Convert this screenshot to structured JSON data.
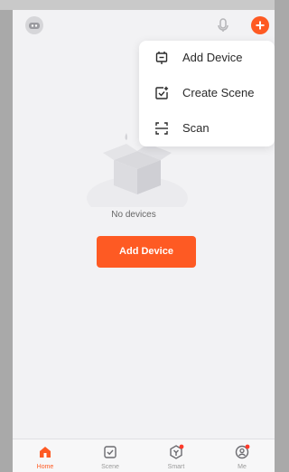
{
  "theme": {
    "accent": "#fe5a23"
  },
  "header": {
    "avatar_icon": "home-robot-icon",
    "mic_icon": "microphone-icon",
    "add_icon": "plus-circle-icon"
  },
  "menu": {
    "items": [
      {
        "label": "Add Device",
        "icon": "add-device-icon"
      },
      {
        "label": "Create Scene",
        "icon": "create-scene-icon"
      },
      {
        "label": "Scan",
        "icon": "scan-icon"
      }
    ]
  },
  "empty_state": {
    "illustration": "empty-box-icon",
    "message": "No devices",
    "button_label": "Add Device"
  },
  "tabs": [
    {
      "label": "Home",
      "icon": "home-icon",
      "active": true
    },
    {
      "label": "Scene",
      "icon": "scene-checkbox-icon",
      "active": false
    },
    {
      "label": "Smart",
      "icon": "smart-icon",
      "active": false,
      "badge": true
    },
    {
      "label": "Me",
      "icon": "profile-icon",
      "active": false,
      "badge": true
    }
  ]
}
